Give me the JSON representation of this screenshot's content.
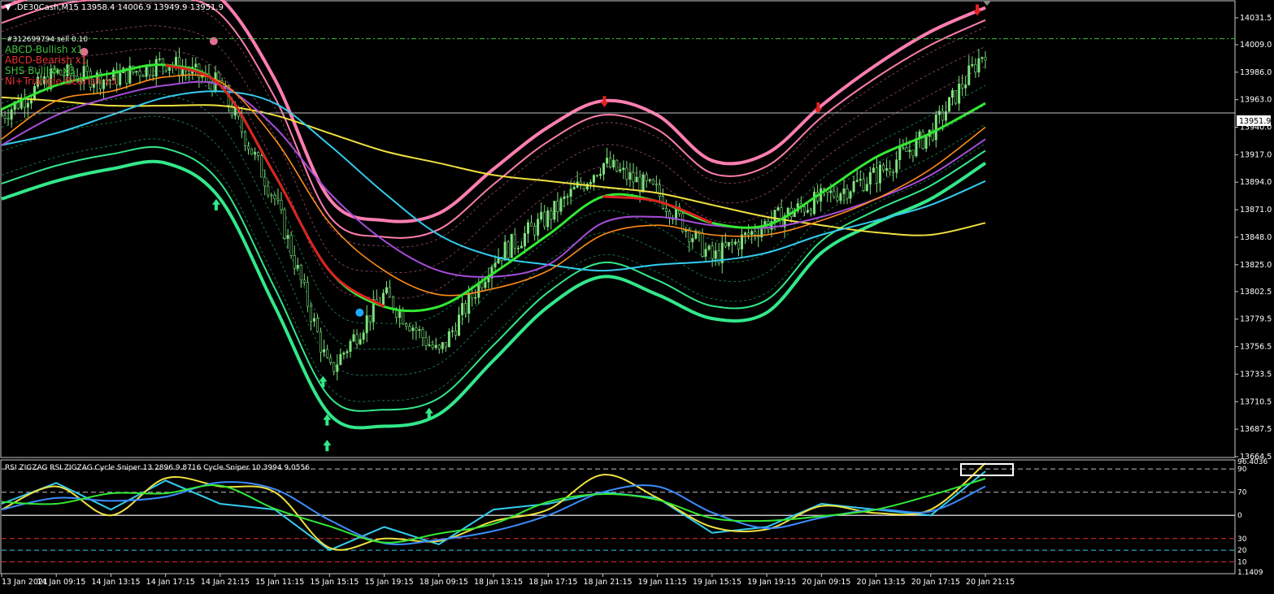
{
  "header": {
    "symbol_line": ".DE30Cash,M15  13958.4 14006.9 13949.9 13951.9"
  },
  "order_label": "#312699794 sell 0.10",
  "patterns": [
    {
      "text": "ABCD-Bullish x1",
      "color": "#3cbf3c"
    },
    {
      "text": "ABCD-Bearish x1",
      "color": "#e03030"
    },
    {
      "text": "SHS Bullish x3",
      "color": "#3cbf3c"
    },
    {
      "text": "NI+Triangle-Bearish x3",
      "color": "#e03030"
    }
  ],
  "price_axis": {
    "ticks": [
      "14031.5",
      "14009.0",
      "13986.0",
      "13963.0",
      "13940.0",
      "13917.0",
      "13894.0",
      "13871.0",
      "13848.0",
      "13825.0",
      "13802.5",
      "13779.5",
      "13756.5",
      "13733.5",
      "13710.5",
      "13687.5",
      "13664.5"
    ],
    "current_price": "13951.9"
  },
  "time_axis": {
    "labels": [
      "13 Jan 2021",
      "14 Jan 09:15",
      "14 Jan 13:15",
      "14 Jan 17:15",
      "14 Jan 21:15",
      "15 Jan 11:15",
      "15 Jan 15:15",
      "15 Jan 19:15",
      "18 Jan 09:15",
      "18 Jan 13:15",
      "18 Jan 17:15",
      "18 Jan 21:15",
      "19 Jan 11:15",
      "19 Jan 15:15",
      "19 Jan 19:15",
      "20 Jan 09:15",
      "20 Jan 13:15",
      "20 Jan 17:15",
      "20 Jan 21:15"
    ]
  },
  "subwindow": {
    "title": "RSI ZIGZAG  RSI ZIGZAG  Cycle Sniper 13.2896 9.8716  Cycle Sniper 10.3994 9.0556",
    "axis_labels": [
      "96.4036",
      "90",
      "70",
      "0",
      "30",
      "20",
      "10",
      "1.1409"
    ]
  },
  "colors": {
    "background": "#000000",
    "candle": "#7de37d",
    "band_upper": "#ff7eb0",
    "band_lower": "#33e88a",
    "ma_green": "#33e833",
    "ma_orange": "#ff8c1a",
    "ma_purple": "#a64dd9",
    "ma_cyan": "#33ccee",
    "ma_yellow": "#f0e040",
    "ma_red": "#e02020",
    "grid_line": "#c0c0c0"
  },
  "chart_data": [
    {
      "type": "line",
      "title": ".DE30Cash,M15",
      "x": [
        "13 Jan 2021",
        "14 Jan 09:15",
        "14 Jan 13:15",
        "14 Jan 17:15",
        "14 Jan 21:15",
        "15 Jan 11:15",
        "15 Jan 15:15",
        "15 Jan 19:15",
        "18 Jan 09:15",
        "18 Jan 13:15",
        "18 Jan 17:15",
        "18 Jan 21:15",
        "19 Jan 11:15",
        "19 Jan 15:15",
        "19 Jan 19:15",
        "20 Jan 09:15",
        "20 Jan 13:15",
        "20 Jan 17:15",
        "20 Jan 21:15"
      ],
      "ylim": [
        13664.5,
        14045
      ],
      "series": [
        {
          "name": "Close",
          "values": [
            13950,
            13985,
            13980,
            13995,
            13975,
            13880,
            13735,
            13800,
            13750,
            13830,
            13865,
            13910,
            13885,
            13830,
            13860,
            13880,
            13900,
            13935,
            14005
          ]
        },
        {
          "name": "Upper Band",
          "values": [
            14040,
            14055,
            14060,
            14062,
            14048,
            13980,
            13880,
            13862,
            13868,
            13905,
            13940,
            13962,
            13950,
            13912,
            13918,
            13958,
            13992,
            14020,
            14040
          ]
        },
        {
          "name": "Lower Band",
          "values": [
            13880,
            13895,
            13905,
            13910,
            13880,
            13790,
            13700,
            13690,
            13700,
            13745,
            13790,
            13815,
            13800,
            13780,
            13785,
            13835,
            13860,
            13880,
            13910
          ]
        },
        {
          "name": "MA Green",
          "values": [
            13955,
            13975,
            13985,
            13992,
            13975,
            13900,
            13820,
            13790,
            13790,
            13818,
            13850,
            13882,
            13878,
            13860,
            13858,
            13885,
            13915,
            13935,
            13960
          ]
        },
        {
          "name": "MA Orange",
          "values": [
            13930,
            13962,
            13970,
            13982,
            13978,
            13930,
            13860,
            13820,
            13800,
            13805,
            13820,
            13850,
            13858,
            13850,
            13850,
            13862,
            13880,
            13905,
            13940
          ]
        },
        {
          "name": "MA Purple",
          "values": [
            13925,
            13950,
            13965,
            13975,
            13975,
            13940,
            13885,
            13845,
            13820,
            13815,
            13825,
            13860,
            13865,
            13858,
            13856,
            13865,
            13880,
            13900,
            13930
          ]
        },
        {
          "name": "MA Cyan",
          "values": [
            13925,
            13935,
            13950,
            13965,
            13970,
            13960,
            13925,
            13885,
            13850,
            13832,
            13825,
            13820,
            13825,
            13828,
            13835,
            13850,
            13862,
            13875,
            13895
          ]
        },
        {
          "name": "MA Yellow",
          "values": [
            13965,
            13962,
            13958,
            13958,
            13958,
            13950,
            13935,
            13920,
            13910,
            13900,
            13895,
            13890,
            13885,
            13875,
            13865,
            13858,
            13852,
            13850,
            13860
          ]
        }
      ]
    },
    {
      "type": "line",
      "title": "RSI ZIGZAG / Cycle Sniper",
      "x": [
        "13 Jan 2021",
        "14 Jan 09:15",
        "14 Jan 13:15",
        "14 Jan 17:15",
        "14 Jan 21:15",
        "15 Jan 11:15",
        "15 Jan 15:15",
        "15 Jan 19:15",
        "18 Jan 09:15",
        "18 Jan 13:15",
        "18 Jan 17:15",
        "18 Jan 21:15",
        "19 Jan 11:15",
        "19 Jan 15:15",
        "19 Jan 19:15",
        "20 Jan 09:15",
        "20 Jan 13:15",
        "20 Jan 17:15",
        "20 Jan 21:15"
      ],
      "ylim": [
        1.1409,
        96.4036
      ],
      "levels": [
        90,
        70,
        50,
        30,
        20,
        10
      ],
      "series": [
        {
          "name": "RSI ZIGZAG",
          "values": [
            60,
            78,
            55,
            80,
            60,
            55,
            20,
            40,
            25,
            55,
            60,
            70,
            65,
            35,
            40,
            60,
            55,
            50,
            88
          ]
        },
        {
          "name": "Cycle Sniper",
          "values": [
            55,
            75,
            50,
            82,
            75,
            70,
            22,
            30,
            28,
            45,
            55,
            85,
            65,
            40,
            38,
            58,
            52,
            55,
            95
          ]
        }
      ]
    }
  ]
}
